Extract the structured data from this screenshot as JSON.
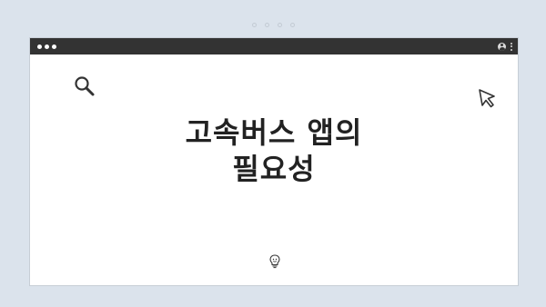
{
  "page": {
    "title_line1": "고속버스 앱의",
    "title_line2": "필요성"
  },
  "icons": {
    "search": "search-icon",
    "cursor": "cursor-pointer-icon",
    "bulb": "lightbulb-icon",
    "user": "user-icon",
    "menu": "kebab-menu-icon"
  },
  "colors": {
    "background": "#dbe3ec",
    "titlebar": "#333333",
    "window": "#ffffff",
    "text": "#222222"
  }
}
